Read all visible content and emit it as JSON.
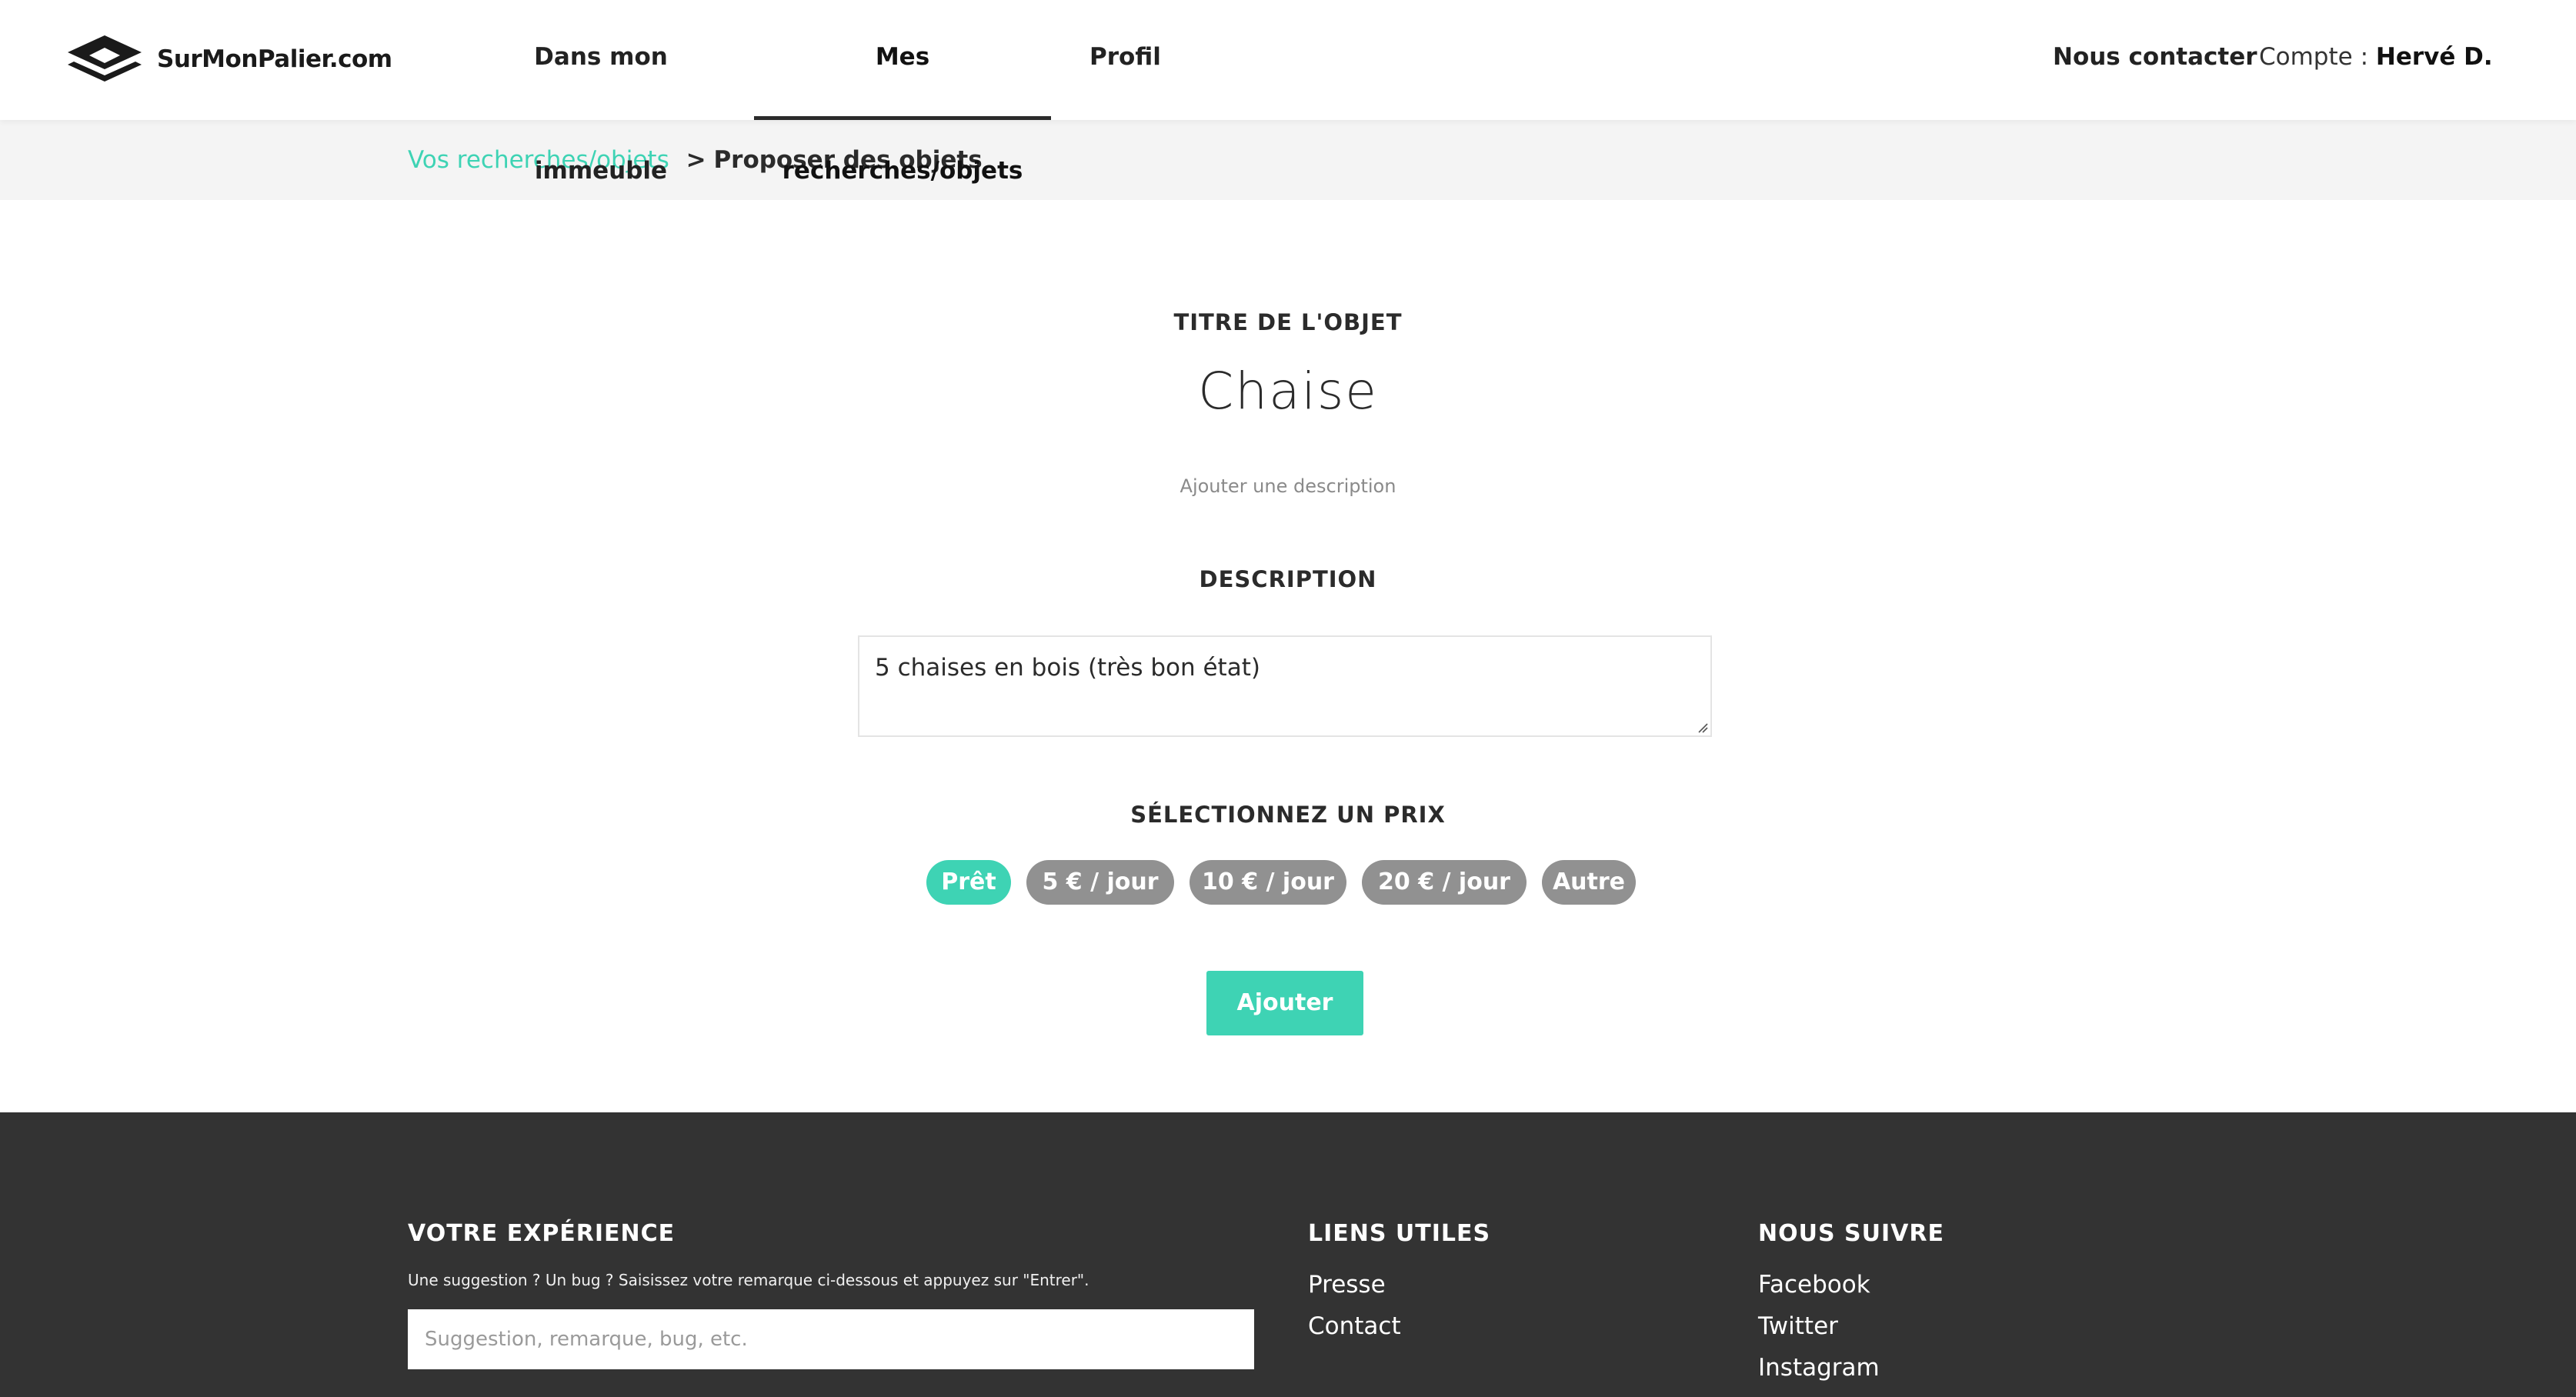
{
  "header": {
    "logo_text": "SurMonPalier.com",
    "nav": [
      {
        "label": "Dans mon immeuble"
      },
      {
        "label": "Mes recherches/objets",
        "active": true
      },
      {
        "label": "Profil"
      }
    ],
    "contact_label": "Nous contacter",
    "account_prefix": "Compte :",
    "account_name": "Hervé D."
  },
  "breadcrumb": {
    "link": "Vos recherches/objets",
    "separator": ">",
    "current": "Proposer des objets"
  },
  "form": {
    "title_label": "TITRE DE L'OBJET",
    "title_value": "Chaise",
    "add_description": "Ajouter une description",
    "description_label": "DESCRIPTION",
    "description_value": "5 chaises en bois (très bon état)",
    "price_label": "SÉLECTIONNEZ UN PRIX",
    "price_options": [
      {
        "label": "Prêt",
        "selected": true
      },
      {
        "label": "5 € / jour",
        "selected": false
      },
      {
        "label": "10 € / jour",
        "selected": false
      },
      {
        "label": "20 € / jour",
        "selected": false
      },
      {
        "label": "Autre",
        "selected": false
      }
    ],
    "submit_label": "Ajouter"
  },
  "footer": {
    "experience": {
      "heading": "VOTRE EXPÉRIENCE",
      "text": "Une suggestion ? Un bug ? Saisissez votre remarque ci-dessous et appuyez sur \"Entrer\".",
      "placeholder": "Suggestion, remarque, bug, etc."
    },
    "links": {
      "heading": "LIENS UTILES",
      "items": [
        "Presse",
        "Contact"
      ]
    },
    "follow": {
      "heading": "NOUS SUIVRE",
      "items": [
        "Facebook",
        "Twitter",
        "Instagram"
      ]
    }
  },
  "colors": {
    "accent": "#3ed3b4",
    "pill_inactive": "#919191",
    "footer_bg": "#333333",
    "breadcrumb_bg": "#f4f4f4"
  },
  "icons": {
    "logo": "stacked-layers-icon"
  }
}
